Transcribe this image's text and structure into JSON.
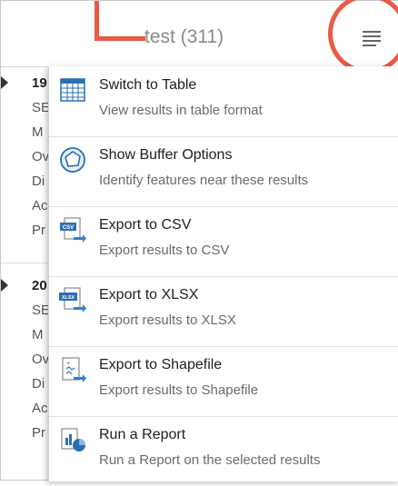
{
  "header": {
    "title": "test (311)"
  },
  "background_list": [
    {
      "num": "19",
      "lines": [
        "SE",
        "M",
        "Ov",
        "Di",
        "Ac",
        "Pr"
      ]
    },
    {
      "num": "20",
      "lines": [
        "SE",
        "M",
        "Ov",
        "Di",
        "Ac",
        "Pr"
      ]
    }
  ],
  "menu": {
    "items": [
      {
        "title": "Switch to Table",
        "subtitle": "View results in table format",
        "icon": "table-icon"
      },
      {
        "title": "Show Buffer Options",
        "subtitle": "Identify features near these results",
        "icon": "buffer-icon"
      },
      {
        "title": "Export to CSV",
        "subtitle": "Export results to CSV",
        "icon": "csv-export-icon"
      },
      {
        "title": "Export to XLSX",
        "subtitle": "Export results to XLSX",
        "icon": "xlsx-export-icon"
      },
      {
        "title": "Export to Shapefile",
        "subtitle": "Export results to Shapefile",
        "icon": "shapefile-export-icon"
      },
      {
        "title": "Run a Report",
        "subtitle": "Run a Report on the selected results",
        "icon": "report-icon"
      }
    ]
  },
  "colors": {
    "annotation": "#e85a45",
    "accent": "#2a7fd4"
  }
}
